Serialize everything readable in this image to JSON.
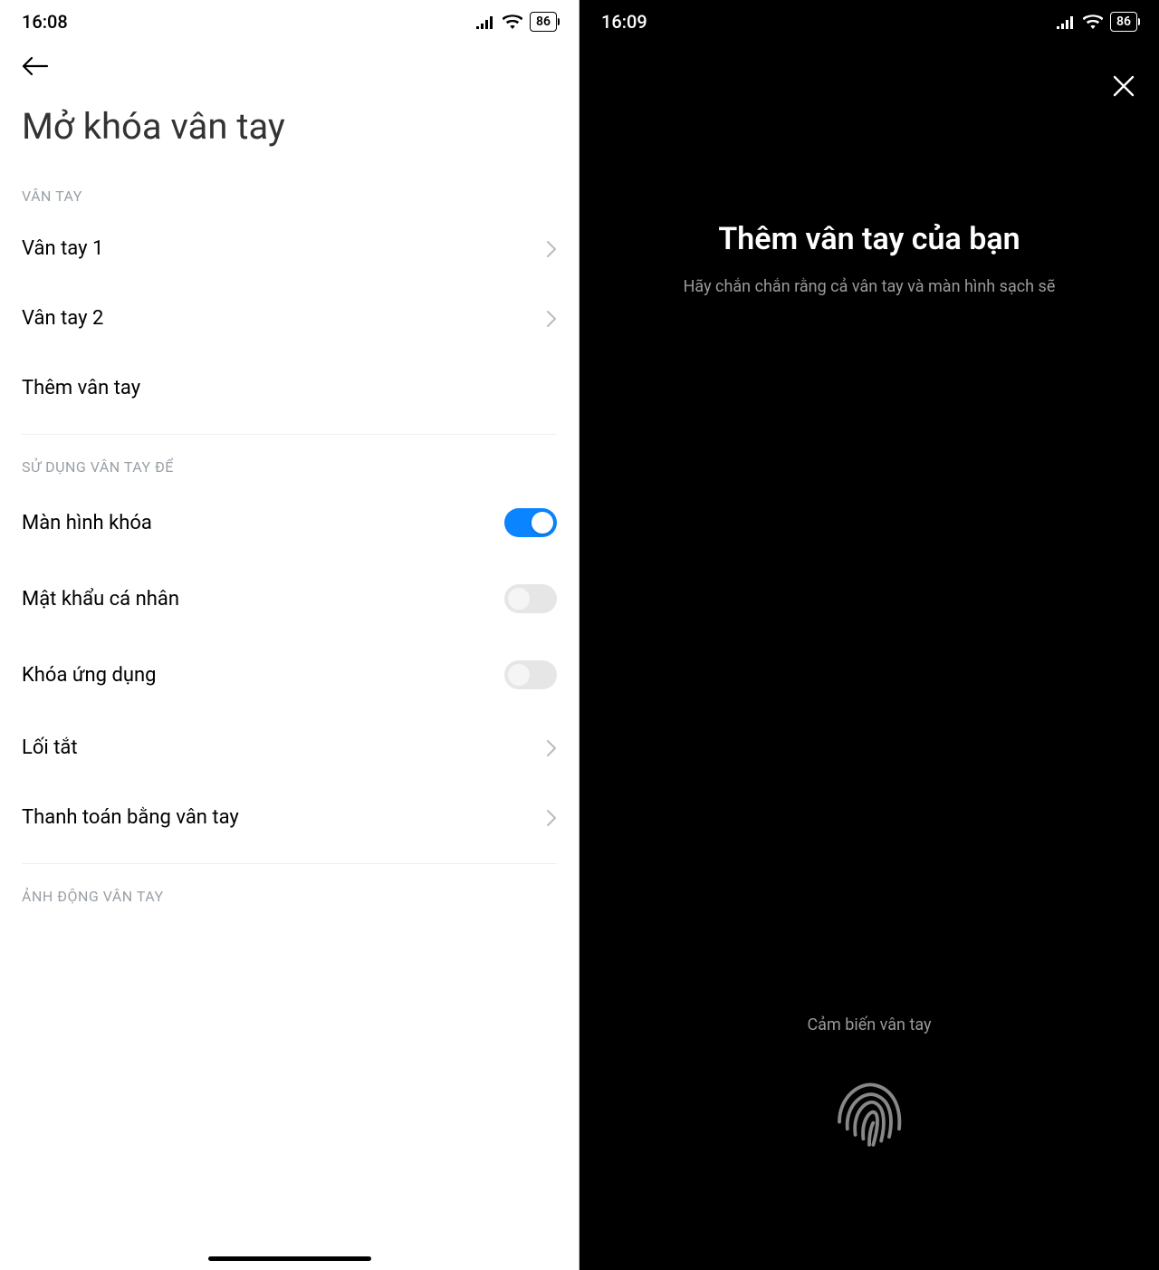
{
  "left": {
    "status": {
      "time": "16:08",
      "battery": "86"
    },
    "title": "Mở khóa vân tay",
    "sections": {
      "fingerprints": {
        "header": "VÂN TAY",
        "items": [
          {
            "label": "Vân tay 1"
          },
          {
            "label": "Vân tay 2"
          },
          {
            "label": "Thêm vân tay"
          }
        ]
      },
      "usage": {
        "header": "SỬ DỤNG VÂN TAY ĐỂ",
        "items": [
          {
            "label": "Màn hình khóa",
            "toggle": true
          },
          {
            "label": "Mật khẩu cá nhân",
            "toggle": false
          },
          {
            "label": "Khóa ứng dụng",
            "toggle": false
          },
          {
            "label": "Lối tắt"
          },
          {
            "label": "Thanh toán bằng vân tay"
          }
        ]
      },
      "animation": {
        "header": "ẢNH ĐỘNG VÂN TAY"
      }
    }
  },
  "right": {
    "status": {
      "time": "16:09",
      "battery": "86"
    },
    "title": "Thêm vân tay của bạn",
    "subtitle": "Hãy chắn chắn rằng cả vân tay và màn hình sạch sẽ",
    "sensor_label": "Cảm biến vân tay"
  }
}
